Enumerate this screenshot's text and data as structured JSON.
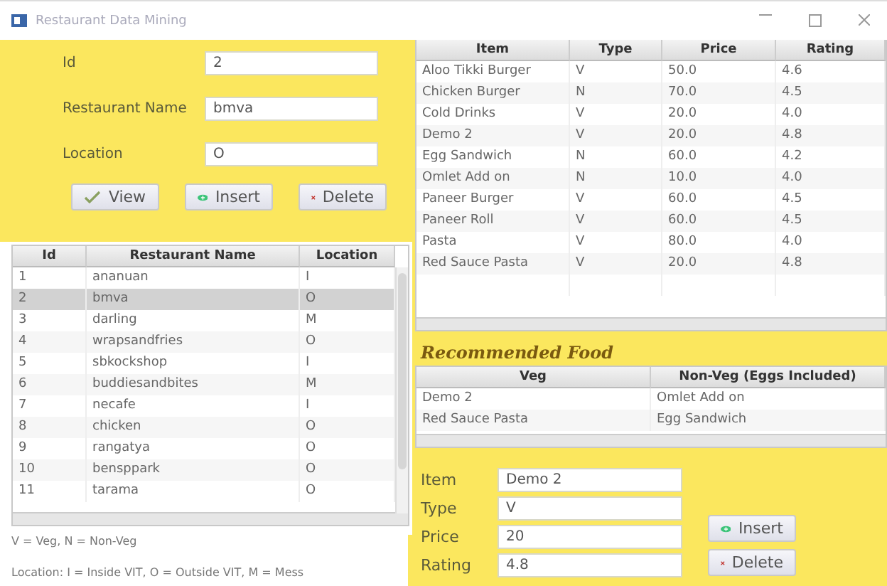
{
  "window": {
    "title": "Restaurant Data Mining"
  },
  "restaurant_form": {
    "fields": [
      {
        "label": "Id",
        "value": "2"
      },
      {
        "label": "Restaurant Name",
        "value": "bmva"
      },
      {
        "label": "Location",
        "value": "O"
      }
    ],
    "buttons": [
      {
        "kind": "view",
        "label": "View"
      },
      {
        "kind": "insert",
        "label": "Insert"
      },
      {
        "kind": "delete",
        "label": "Delete"
      }
    ]
  },
  "restaurants": {
    "columns": [
      "Id",
      "Restaurant Name",
      "Location"
    ],
    "rows": [
      {
        "cells": [
          "1",
          "ananuan",
          "I"
        ],
        "selected": false
      },
      {
        "cells": [
          "2",
          "bmva",
          "O"
        ],
        "selected": true
      },
      {
        "cells": [
          "3",
          "darling",
          "M"
        ],
        "selected": false
      },
      {
        "cells": [
          "4",
          "wrapsandfries",
          "O"
        ],
        "selected": false
      },
      {
        "cells": [
          "5",
          "sbkockshop",
          "I"
        ],
        "selected": false
      },
      {
        "cells": [
          "6",
          "buddiesandbites",
          "M"
        ],
        "selected": false
      },
      {
        "cells": [
          "7",
          "necafe",
          "I"
        ],
        "selected": false
      },
      {
        "cells": [
          "8",
          "chicken",
          "O"
        ],
        "selected": false
      },
      {
        "cells": [
          "9",
          "rangatya",
          "O"
        ],
        "selected": false
      },
      {
        "cells": [
          "10",
          "bensppark",
          "O"
        ],
        "selected": false
      },
      {
        "cells": [
          "11",
          "tarama",
          "O"
        ],
        "selected": false
      }
    ]
  },
  "legend": [
    "V = Veg, N = Non-Veg",
    "Location: I = Inside VIT, O = Outside VIT, M = Mess"
  ],
  "menu": {
    "columns": [
      "Item",
      "Type",
      "Price",
      "Rating"
    ],
    "rows": [
      [
        "Aloo Tikki Burger",
        "V",
        "50.0",
        "4.6"
      ],
      [
        "Chicken Burger",
        "N",
        "70.0",
        "4.5"
      ],
      [
        "Cold Drinks",
        "V",
        "20.0",
        "4.0"
      ],
      [
        "Demo 2",
        "V",
        "20.0",
        "4.8"
      ],
      [
        "Egg Sandwich",
        "N",
        "60.0",
        "4.2"
      ],
      [
        "Omlet Add on",
        "N",
        "10.0",
        "4.0"
      ],
      [
        "Paneer Burger",
        "V",
        "60.0",
        "4.5"
      ],
      [
        "Paneer Roll",
        "V",
        "60.0",
        "4.5"
      ],
      [
        "Pasta",
        "V",
        "80.0",
        "4.0"
      ],
      [
        "Red Sauce Pasta",
        "V",
        "20.0",
        "4.8"
      ]
    ]
  },
  "recommended": {
    "title": "Recommended Food",
    "columns": [
      "Veg",
      "Non-Veg (Eggs Included)"
    ],
    "rows": [
      [
        "Demo 2",
        "Omlet Add on"
      ],
      [
        "Red Sauce Pasta",
        "Egg Sandwich"
      ]
    ]
  },
  "item_form": {
    "fields": [
      {
        "label": "Item",
        "value": "Demo 2"
      },
      {
        "label": "Type",
        "value": "V"
      },
      {
        "label": "Price",
        "value": "20"
      },
      {
        "label": "Rating",
        "value": "4.8"
      }
    ],
    "buttons": [
      {
        "kind": "insert",
        "label": "Insert"
      },
      {
        "kind": "delete",
        "label": "Delete"
      }
    ]
  }
}
